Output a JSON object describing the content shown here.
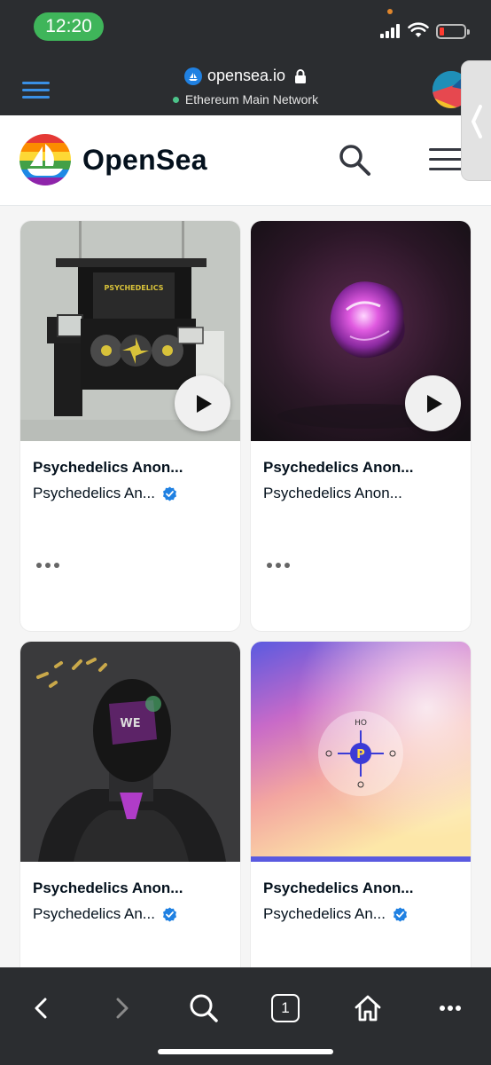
{
  "status_bar": {
    "time": "12:20",
    "icons": [
      "signal-icon",
      "wifi-icon",
      "battery-low-icon"
    ]
  },
  "browser": {
    "url": "opensea.io",
    "network": "Ethereum Main Network",
    "icons": [
      "menu-icon",
      "site-icon",
      "lock-icon",
      "account-avatar"
    ]
  },
  "header": {
    "brand": "OpenSea",
    "icons": [
      "opensea-logo-icon",
      "search-icon",
      "menu-icon"
    ]
  },
  "cards": [
    {
      "title": "Psychedelics Anon...",
      "collection": "Psychedelics An...",
      "verified": true,
      "has_play": true,
      "image": "psychedelics-machine-image"
    },
    {
      "title": "Psychedelics Anon...",
      "collection": "Psychedelics Anon...",
      "verified": false,
      "has_play": true,
      "image": "purple-orb-image"
    },
    {
      "title": "Psychedelics Anon...",
      "collection": "Psychedelics An...",
      "verified": true,
      "has_play": false,
      "image": "masked-figure-image"
    },
    {
      "title": "Psychedelics Anon...",
      "collection": "Psychedelics An...",
      "verified": true,
      "has_play": false,
      "image": "gradient-compass-image"
    }
  ],
  "compass": {
    "top": "HO",
    "center": "P"
  },
  "toolbar": {
    "tab_count": "1",
    "icons": [
      "back-icon",
      "forward-icon",
      "search-icon",
      "tabs-icon",
      "home-icon",
      "more-icon"
    ]
  },
  "colors": {
    "accent": "#2081e2",
    "dark_bar": "#2b2d30",
    "time_pill": "#3fb55a",
    "verified_blue": "#2081e2"
  }
}
